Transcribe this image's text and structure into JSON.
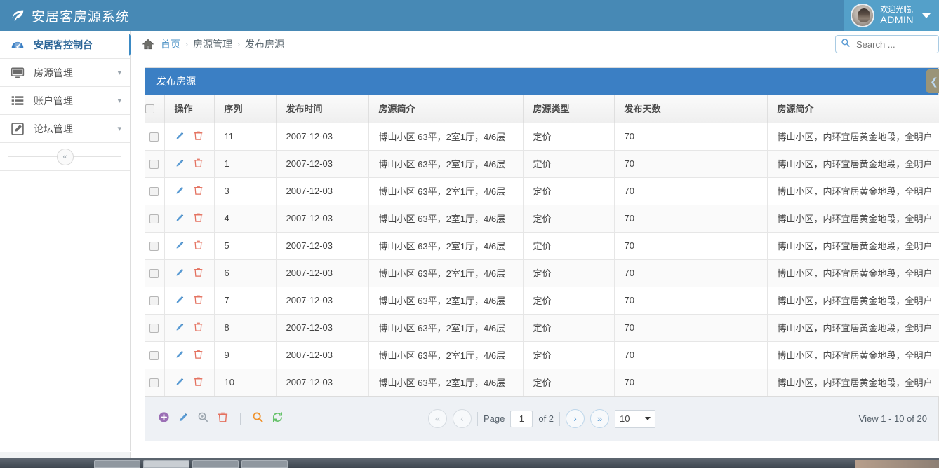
{
  "header": {
    "brand_title": "安居客房源系统",
    "logo_icon": "leaf-icon",
    "user": {
      "welcome": "欢迎光临,",
      "name": "ADMIN",
      "caret_icon": "chevron-down-icon",
      "avatar_icon": "avatar"
    }
  },
  "sidebar": {
    "items": [
      {
        "label": "安居客控制台",
        "icon": "dashboard-icon",
        "active": true,
        "has_chevron": false
      },
      {
        "label": "房源管理",
        "icon": "monitor-icon",
        "active": false,
        "has_chevron": true
      },
      {
        "label": "账户管理",
        "icon": "list-icon",
        "active": false,
        "has_chevron": true
      },
      {
        "label": "论坛管理",
        "icon": "edit-square-icon",
        "active": false,
        "has_chevron": true
      }
    ],
    "collapse_label": "«"
  },
  "breadcrumb": {
    "home_icon": "home-icon",
    "items": [
      "首页",
      "房源管理",
      "发布房源"
    ],
    "separator": "›"
  },
  "search": {
    "placeholder": "Search ...",
    "value": "",
    "icon": "search-icon"
  },
  "panel": {
    "title": "发布房源",
    "side_button_icon": "chevron-left-icon"
  },
  "table": {
    "columns": [
      {
        "key": "check",
        "label": ""
      },
      {
        "key": "op",
        "label": "操作"
      },
      {
        "key": "seq",
        "label": "序列"
      },
      {
        "key": "time",
        "label": "发布时间"
      },
      {
        "key": "desc",
        "label": "房源简介"
      },
      {
        "key": "type",
        "label": "房源类型"
      },
      {
        "key": "days",
        "label": "发布天数"
      },
      {
        "key": "desc2",
        "label": "房源简介"
      }
    ],
    "row_icons": {
      "edit": "pencil-icon",
      "delete": "trash-icon"
    },
    "rows": [
      {
        "seq": "11",
        "time": "2007-12-03",
        "desc": "博山小区 63平，2室1厅，4/6层",
        "type": "定价",
        "days": "70",
        "desc2": "博山小区，内环宜居黄金地段，全明户"
      },
      {
        "seq": "1",
        "time": "2007-12-03",
        "desc": "博山小区 63平，2室1厅，4/6层",
        "type": "定价",
        "days": "70",
        "desc2": "博山小区，内环宜居黄金地段，全明户"
      },
      {
        "seq": "3",
        "time": "2007-12-03",
        "desc": "博山小区 63平，2室1厅，4/6层",
        "type": "定价",
        "days": "70",
        "desc2": "博山小区，内环宜居黄金地段，全明户"
      },
      {
        "seq": "4",
        "time": "2007-12-03",
        "desc": "博山小区 63平，2室1厅，4/6层",
        "type": "定价",
        "days": "70",
        "desc2": "博山小区，内环宜居黄金地段，全明户"
      },
      {
        "seq": "5",
        "time": "2007-12-03",
        "desc": "博山小区 63平，2室1厅，4/6层",
        "type": "定价",
        "days": "70",
        "desc2": "博山小区，内环宜居黄金地段，全明户"
      },
      {
        "seq": "6",
        "time": "2007-12-03",
        "desc": "博山小区 63平，2室1厅，4/6层",
        "type": "定价",
        "days": "70",
        "desc2": "博山小区，内环宜居黄金地段，全明户"
      },
      {
        "seq": "7",
        "time": "2007-12-03",
        "desc": "博山小区 63平，2室1厅，4/6层",
        "type": "定价",
        "days": "70",
        "desc2": "博山小区，内环宜居黄金地段，全明户"
      },
      {
        "seq": "8",
        "time": "2007-12-03",
        "desc": "博山小区 63平，2室1厅，4/6层",
        "type": "定价",
        "days": "70",
        "desc2": "博山小区，内环宜居黄金地段，全明户"
      },
      {
        "seq": "9",
        "time": "2007-12-03",
        "desc": "博山小区 63平，2室1厅，4/6层",
        "type": "定价",
        "days": "70",
        "desc2": "博山小区，内环宜居黄金地段，全明户"
      },
      {
        "seq": "10",
        "time": "2007-12-03",
        "desc": "博山小区 63平，2室1厅，4/6层",
        "type": "定价",
        "days": "70",
        "desc2": "博山小区，内环宜居黄金地段，全明户"
      }
    ]
  },
  "pager": {
    "tools": [
      {
        "icon": "add-icon",
        "color": "#9b6fb5"
      },
      {
        "icon": "pencil-icon",
        "color": "#5a9bd4"
      },
      {
        "icon": "zoom-in-icon",
        "color": "#9aa4ad"
      },
      {
        "icon": "trash-icon",
        "color": "#e4705e"
      },
      {
        "icon": "search-icon",
        "color": "#f0922b"
      },
      {
        "icon": "refresh-icon",
        "color": "#63c167"
      }
    ],
    "first_icon": "double-chevron-left-icon",
    "prev_icon": "chevron-left-icon",
    "next_icon": "chevron-right-icon",
    "last_icon": "double-chevron-right-icon",
    "page_label": "Page",
    "page_value": "1",
    "of_label": "of 2",
    "page_size": "10",
    "view_label": "View 1 - 10 of 20"
  },
  "colors": {
    "header_blue": "#4789b5",
    "panel_blue": "#3b7fc4",
    "link_blue": "#4a90c4",
    "pager_bg": "#eef1f5"
  }
}
